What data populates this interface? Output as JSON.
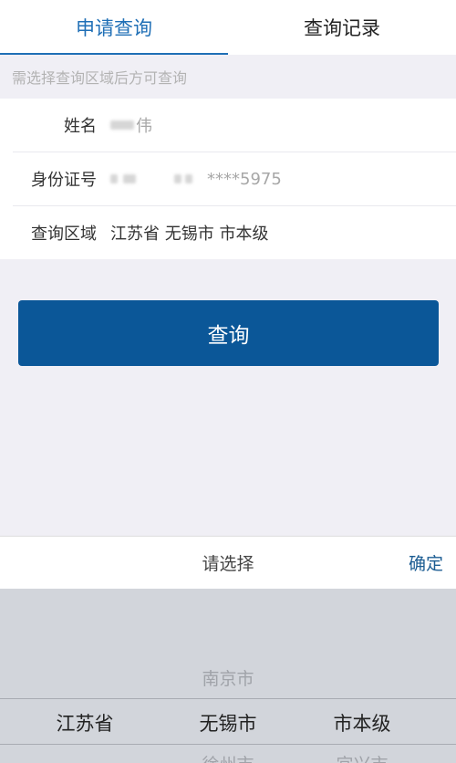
{
  "tabs": {
    "apply_label": "申请查询",
    "records_label": "查询记录"
  },
  "hint": "需选择查询区域后方可查询",
  "form": {
    "name_label": "姓名",
    "name_value": "伟",
    "id_label": "身份证号",
    "id_value": "****5975",
    "region_label": "查询区域",
    "region_value": "江苏省 无锡市 市本级"
  },
  "query_button": "查询",
  "picker": {
    "title": "请选择",
    "confirm": "确定",
    "province_selected": "江苏省",
    "city_above": "南京市",
    "city_selected": "无锡市",
    "city_below": "徐州市",
    "district_selected": "市本级",
    "district_below": "宜兴市"
  }
}
